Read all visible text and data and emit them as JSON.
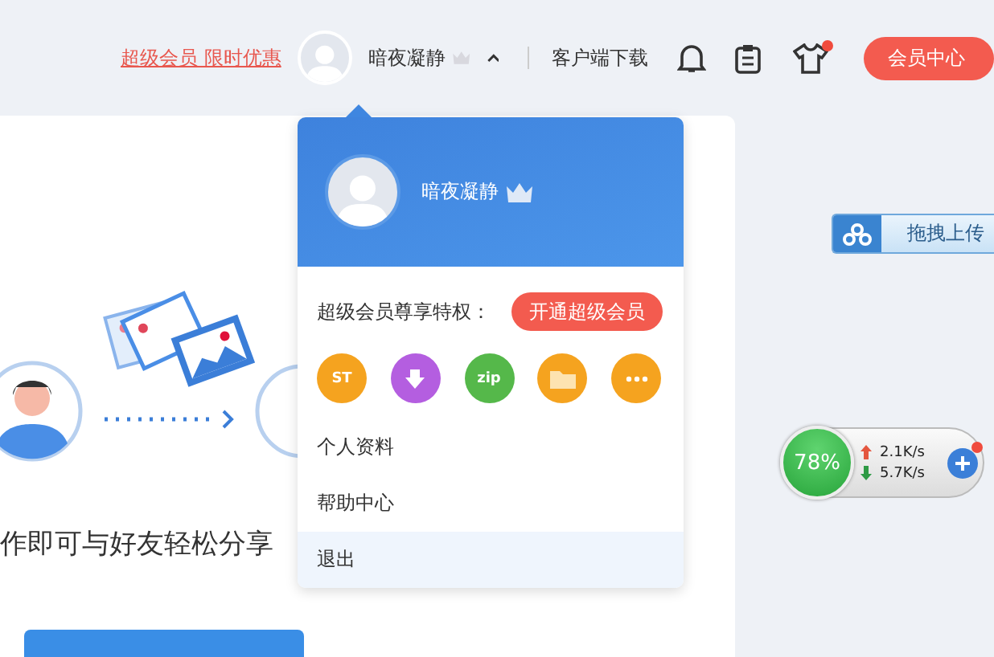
{
  "header": {
    "promo_link": "超级会员 限时优惠",
    "user_name": "暗夜凝静",
    "menu_expanded": true,
    "download_link": "客户端下载",
    "skin_badge": true,
    "member_button": "会员中心"
  },
  "card": {
    "share_text": "作即可与好友轻松分享"
  },
  "user_menu": {
    "user_name": "暗夜凝静",
    "privilege_label": "超级会员尊享特权：",
    "upgrade_button": "开通超级会员",
    "privileges": [
      {
        "kind": "badge",
        "label": "ST",
        "color": "#f5a31f"
      },
      {
        "kind": "download",
        "color": "#b45ee0"
      },
      {
        "kind": "cloud",
        "label": "zip",
        "color": "#55b84a"
      },
      {
        "kind": "folder",
        "color": "#f5a31f"
      },
      {
        "kind": "more",
        "color": "#f5a31f"
      }
    ],
    "items": [
      {
        "label": "个人资料",
        "selected": false
      },
      {
        "label": "帮助中心",
        "selected": false
      },
      {
        "label": "退出",
        "selected": true
      }
    ]
  },
  "float": {
    "upload_button": "拖拽上传",
    "percent": "78%",
    "upload_speed": "2.1K/s",
    "download_speed": "5.7K/s",
    "notification": true
  }
}
